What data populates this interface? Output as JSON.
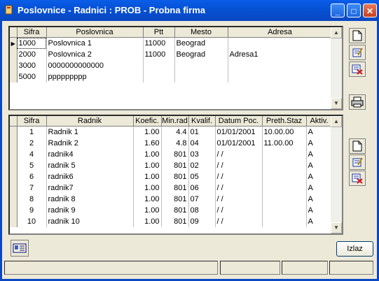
{
  "window": {
    "title": "Poslovnice - Radnici : PROB - Probna firma",
    "minimize": "_",
    "maximize": "□",
    "close": "✕"
  },
  "branches": {
    "columns": [
      "Sifra",
      "Poslovnica",
      "Ptt",
      "Mesto",
      "Adresa"
    ],
    "rows": [
      {
        "sifra": "1000",
        "naziv": "Poslovnica 1",
        "ptt": "11000",
        "mesto": "Beograd",
        "adresa": ""
      },
      {
        "sifra": "2000",
        "naziv": "Poslovnica 2",
        "ptt": "11000",
        "mesto": "Beograd",
        "adresa": "Adresa1"
      },
      {
        "sifra": "3000",
        "naziv": "0000000000000",
        "ptt": "",
        "mesto": "",
        "adresa": ""
      },
      {
        "sifra": "5000",
        "naziv": "ppppppppp",
        "ptt": "",
        "mesto": "",
        "adresa": ""
      }
    ]
  },
  "workers": {
    "columns": [
      "Sifra",
      "Radnik",
      "Koefic.",
      "Min.rad",
      "Kvalif.",
      "Datum Poc.",
      "Preth.Staz",
      "Aktiv."
    ],
    "rows": [
      {
        "sifra": "1",
        "ime": "Radnik 1",
        "koef": "1.00",
        "minrad": "4.4",
        "kvalif": "01",
        "datum": "01/01/2001",
        "staz": "10.00.00",
        "aktiv": "A"
      },
      {
        "sifra": "2",
        "ime": "Radnik 2",
        "koef": "1.60",
        "minrad": "4.8",
        "kvalif": "04",
        "datum": "01/01/2001",
        "staz": "11.00.00",
        "aktiv": "A"
      },
      {
        "sifra": "4",
        "ime": "radnik4",
        "koef": "1.00",
        "minrad": "801",
        "kvalif": "03",
        "datum": "/ /",
        "staz": "",
        "aktiv": "A"
      },
      {
        "sifra": "5",
        "ime": "radnik 5",
        "koef": "1.00",
        "minrad": "801",
        "kvalif": "02",
        "datum": "/ /",
        "staz": "",
        "aktiv": "A"
      },
      {
        "sifra": "6",
        "ime": "radnik6",
        "koef": "1.00",
        "minrad": "801",
        "kvalif": "05",
        "datum": "/ /",
        "staz": "",
        "aktiv": "A"
      },
      {
        "sifra": "7",
        "ime": "radnik7",
        "koef": "1.00",
        "minrad": "801",
        "kvalif": "06",
        "datum": "/ /",
        "staz": "",
        "aktiv": "A"
      },
      {
        "sifra": "8",
        "ime": "radnik 8",
        "koef": "1.00",
        "minrad": "801",
        "kvalif": "07",
        "datum": "/ /",
        "staz": "",
        "aktiv": "A"
      },
      {
        "sifra": "9",
        "ime": "radnik 9",
        "koef": "1.00",
        "minrad": "801",
        "kvalif": "08",
        "datum": "/ /",
        "staz": "",
        "aktiv": "A"
      },
      {
        "sifra": "10",
        "ime": "radnik 10",
        "koef": "1.00",
        "minrad": "801",
        "kvalif": "09",
        "datum": "/ /",
        "staz": "",
        "aktiv": "A"
      }
    ]
  },
  "buttons": {
    "izlaz": "Izlaz",
    "icons": [
      "new-document-icon",
      "edit-icon",
      "delete-icon",
      "print-icon"
    ]
  },
  "colors": {
    "titlebar": "#0a5ee8",
    "face": "#ece9d8",
    "delete_red": "#d01010"
  }
}
